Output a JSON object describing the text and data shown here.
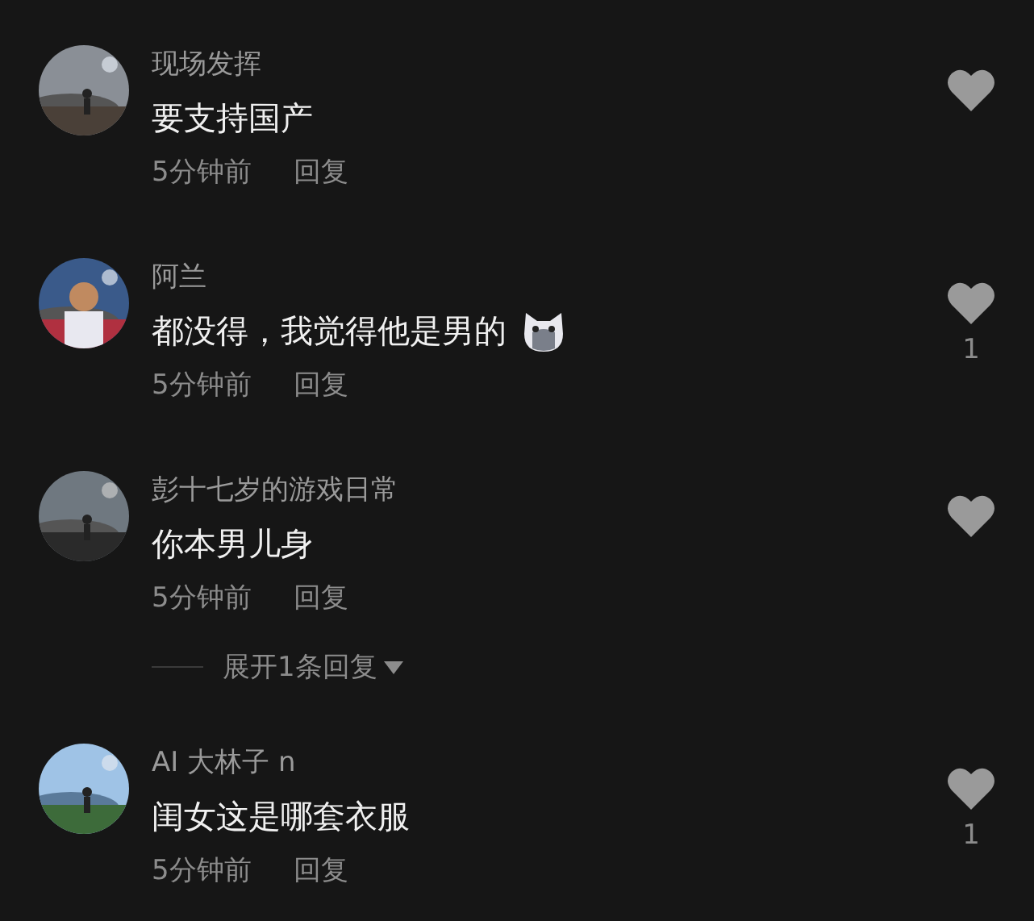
{
  "comments": [
    {
      "user": "现场发挥",
      "text": "要支持国产",
      "emoji": false,
      "time": "5分钟前",
      "reply": "回复"
    },
    {
      "user": "阿兰",
      "text": "都没得，我觉得他是男的",
      "emoji": true,
      "time": "5分钟前",
      "reply": "回复",
      "like_count": "1"
    },
    {
      "user": "彭十七岁的游戏日常",
      "text": "你本男儿身",
      "emoji": false,
      "time": "5分钟前",
      "reply": "回复",
      "expand_replies": "展开1条回复"
    },
    {
      "user": "AI 大林子 n",
      "text": "闺女这是哪套衣服",
      "emoji": false,
      "time": "5分钟前",
      "reply": "回复",
      "like_count": "1"
    }
  ]
}
